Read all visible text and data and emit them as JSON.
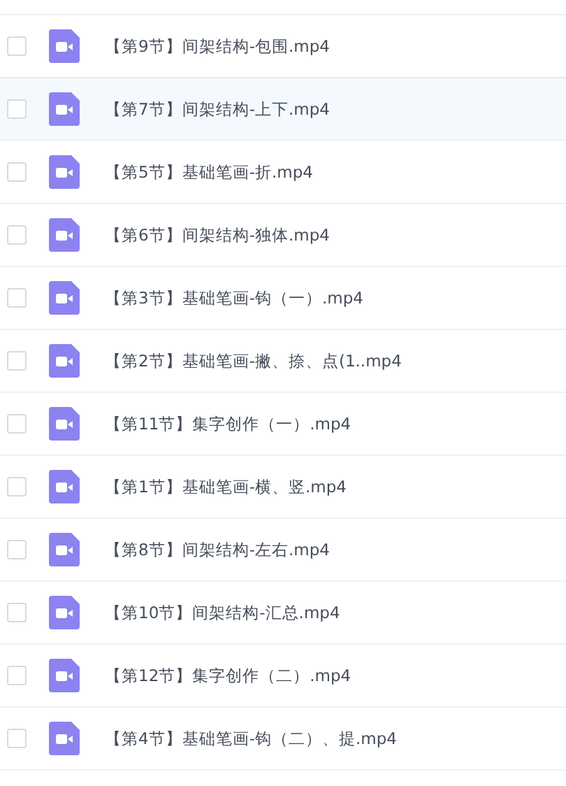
{
  "files": [
    {
      "name": "【第9节】间架结构-包围.mp4",
      "checked": false,
      "highlighted": false
    },
    {
      "name": "【第7节】间架结构-上下.mp4",
      "checked": false,
      "highlighted": true
    },
    {
      "name": "【第5节】基础笔画-折.mp4",
      "checked": false,
      "highlighted": false
    },
    {
      "name": "【第6节】间架结构-独体.mp4",
      "checked": false,
      "highlighted": false
    },
    {
      "name": "【第3节】基础笔画-钩（一）.mp4",
      "checked": false,
      "highlighted": false
    },
    {
      "name": "【第2节】基础笔画-撇、捺、点(1..mp4",
      "checked": false,
      "highlighted": false
    },
    {
      "name": "【第11节】集字创作（一）.mp4",
      "checked": false,
      "highlighted": false
    },
    {
      "name": "【第1节】基础笔画-横、竖.mp4",
      "checked": false,
      "highlighted": false
    },
    {
      "name": "【第8节】间架结构-左右.mp4",
      "checked": false,
      "highlighted": false
    },
    {
      "name": "【第10节】间架结构-汇总.mp4",
      "checked": false,
      "highlighted": false
    },
    {
      "name": "【第12节】集字创作（二）.mp4",
      "checked": false,
      "highlighted": false
    },
    {
      "name": "【第4节】基础笔画-钩（二）、提.mp4",
      "checked": false,
      "highlighted": false
    }
  ]
}
